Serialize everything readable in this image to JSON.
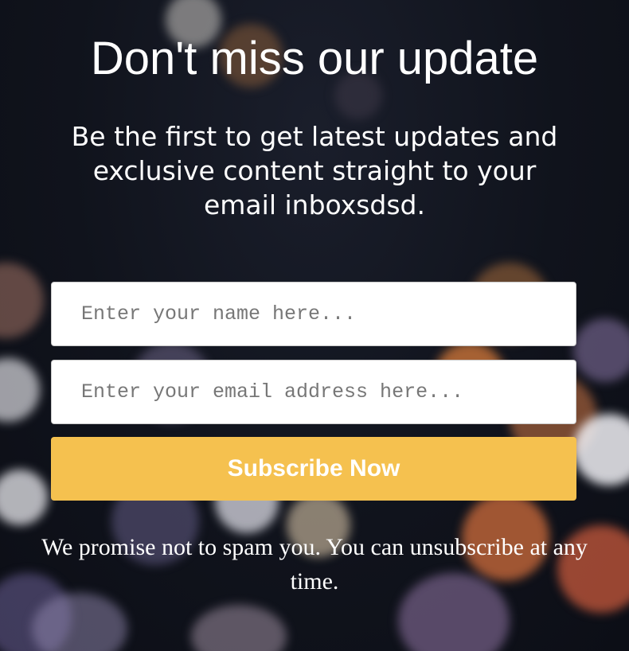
{
  "newsletter": {
    "title": "Don't miss our update",
    "subtitle": "Be the first to get latest updates and exclusive content straight to your email inboxsdsd.",
    "name_placeholder": "Enter your name here...",
    "email_placeholder": "Enter your email address here...",
    "subscribe_label": "Subscribe Now",
    "disclaimer": "We promise not to spam you. You can unsubscribe at any time."
  },
  "colors": {
    "button": "#f5c14f",
    "text": "#ffffff",
    "background": "#12151f"
  }
}
